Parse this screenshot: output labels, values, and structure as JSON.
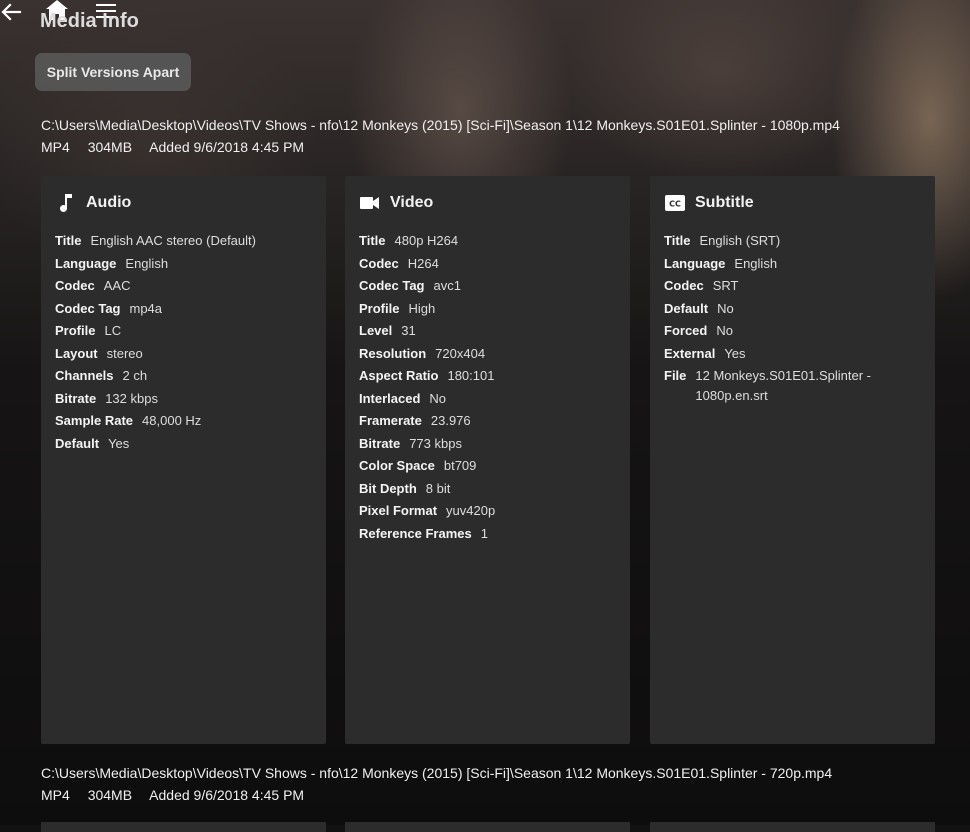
{
  "header": {
    "title": "Media Info",
    "back_icon": "arrow-left-icon",
    "home_icon": "home-icon",
    "menu_icon": "hamburger-menu-icon"
  },
  "split_button": {
    "label": "Split Versions Apart"
  },
  "versions": [
    {
      "path": "C:\\Users\\Media\\Desktop\\Videos\\TV Shows - nfo\\12 Monkeys (2015) [Sci-Fi]\\Season 1\\12 Monkeys.S01E01.Splinter - 1080p.mp4",
      "container": "MP4",
      "size": "304MB",
      "added": "Added 9/6/2018 4:45 PM",
      "audio": {
        "title": "Audio",
        "icon": "music-note-icon",
        "rows": [
          {
            "k": "Title",
            "v": "English AAC stereo (Default)"
          },
          {
            "k": "Language",
            "v": "English"
          },
          {
            "k": "Codec",
            "v": "AAC"
          },
          {
            "k": "Codec Tag",
            "v": "mp4a"
          },
          {
            "k": "Profile",
            "v": "LC"
          },
          {
            "k": "Layout",
            "v": "stereo"
          },
          {
            "k": "Channels",
            "v": "2 ch"
          },
          {
            "k": "Bitrate",
            "v": "132 kbps"
          },
          {
            "k": "Sample Rate",
            "v": "48,000 Hz"
          },
          {
            "k": "Default",
            "v": "Yes"
          }
        ]
      },
      "video": {
        "title": "Video",
        "icon": "video-camera-icon",
        "rows": [
          {
            "k": "Title",
            "v": "480p H264"
          },
          {
            "k": "Codec",
            "v": "H264"
          },
          {
            "k": "Codec Tag",
            "v": "avc1"
          },
          {
            "k": "Profile",
            "v": "High"
          },
          {
            "k": "Level",
            "v": "31"
          },
          {
            "k": "Resolution",
            "v": "720x404"
          },
          {
            "k": "Aspect Ratio",
            "v": "180:101"
          },
          {
            "k": "Interlaced",
            "v": "No"
          },
          {
            "k": "Framerate",
            "v": "23.976"
          },
          {
            "k": "Bitrate",
            "v": "773 kbps"
          },
          {
            "k": "Color Space",
            "v": "bt709"
          },
          {
            "k": "Bit Depth",
            "v": "8 bit"
          },
          {
            "k": "Pixel Format",
            "v": "yuv420p"
          },
          {
            "k": "Reference Frames",
            "v": "1"
          }
        ]
      },
      "subtitle": {
        "title": "Subtitle",
        "icon": "closed-caption-icon",
        "rows": [
          {
            "k": "Title",
            "v": "English (SRT)"
          },
          {
            "k": "Language",
            "v": "English"
          },
          {
            "k": "Codec",
            "v": "SRT"
          },
          {
            "k": "Default",
            "v": "No"
          },
          {
            "k": "Forced",
            "v": "No"
          },
          {
            "k": "External",
            "v": "Yes"
          },
          {
            "k": "File",
            "v": "12 Monkeys.S01E01.Splinter - 1080p.en.srt"
          }
        ]
      }
    },
    {
      "path": "C:\\Users\\Media\\Desktop\\Videos\\TV Shows - nfo\\12 Monkeys (2015) [Sci-Fi]\\Season 1\\12 Monkeys.S01E01.Splinter - 720p.mp4",
      "container": "MP4",
      "size": "304MB",
      "added": "Added 9/6/2018 4:45 PM"
    }
  ]
}
